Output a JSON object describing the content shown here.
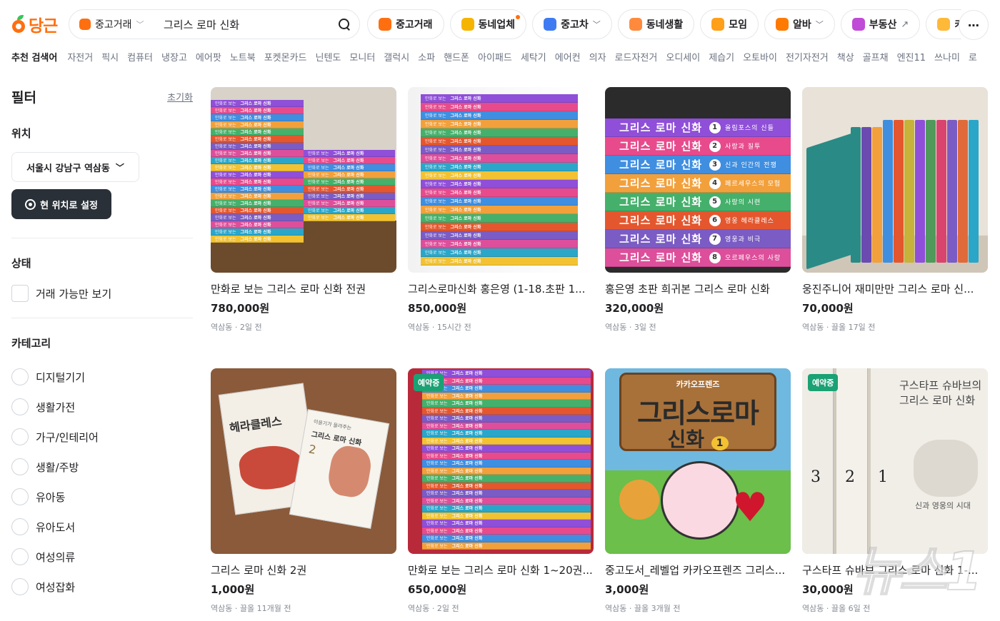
{
  "app": {
    "logo_text": "당근"
  },
  "search": {
    "category": "중고거래",
    "query": "그리스 로마 신화"
  },
  "nav_pills": [
    {
      "label": "중고거래",
      "icon": "used-goods-icon",
      "color": "#ff6f0f"
    },
    {
      "label": "동네업체",
      "icon": "local-store-icon",
      "color": "#f5b400",
      "dot": true
    },
    {
      "label": "중고차",
      "icon": "car-icon",
      "color": "#3e7bf2",
      "chevron": true
    },
    {
      "label": "동네생활",
      "icon": "community-icon",
      "color": "#ff8a3d"
    },
    {
      "label": "모임",
      "icon": "group-icon",
      "color": "#ff9f1a"
    },
    {
      "label": "알바",
      "icon": "job-icon",
      "color": "#ff7a00",
      "chevron": true
    },
    {
      "label": "부동산",
      "icon": "house-icon",
      "color": "#c04bd6",
      "external": true
    },
    {
      "label": "카",
      "icon": "more-service-icon",
      "color": "#ffb938"
    }
  ],
  "keywords": {
    "label": "추천 검색어",
    "items": [
      "자전거",
      "픽시",
      "컴퓨터",
      "냉장고",
      "에어팟",
      "노트북",
      "포켓몬카드",
      "닌텐도",
      "모니터",
      "갤럭시",
      "소파",
      "핸드폰",
      "아이패드",
      "세탁기",
      "에어컨",
      "의자",
      "로드자전거",
      "오디세이",
      "제습기",
      "오토바이",
      "전기자전거",
      "책상",
      "골프채",
      "엔진11",
      "쓰나미",
      "로"
    ]
  },
  "sidebar": {
    "title": "필터",
    "reset": "초기화",
    "location_title": "위치",
    "location_value": "서울시 강남구 역삼동",
    "current_location_button": "현 위치로 설정",
    "status_title": "상태",
    "status_option": "거래 가능만 보기",
    "category_title": "카테고리",
    "categories": [
      "디지털기기",
      "생활가전",
      "가구/인테리어",
      "생활/주방",
      "유아동",
      "유아도서",
      "여성의류",
      "여성잡화"
    ]
  },
  "products": [
    {
      "title": "만화로 보는 그리스 로마 신화 전권",
      "price": "780,000원",
      "meta": "역삼동 · 2일 전"
    },
    {
      "title": "그리스로마신화 홍은영 (1-18.초판 1...",
      "price": "850,000원",
      "meta": "역삼동 · 15시간 전"
    },
    {
      "title": "홍은영 초판 희귀본 그리스 로마 신화",
      "price": "320,000원",
      "meta": "역삼동 · 3일 전"
    },
    {
      "title": "웅진주니어 재미만만 그리스 로마 신...",
      "price": "70,000원",
      "meta": "역삼동 · 끌올 17일 전"
    },
    {
      "title": "그리스 로마 신화 2권",
      "price": "1,000원",
      "meta": "역삼동 · 끌올 11개월 전"
    },
    {
      "title": "만화로 보는 그리스 로마 신화 1~20권...",
      "price": "650,000원",
      "meta": "역삼동 · 2일 전",
      "badge": "예약중"
    },
    {
      "title": "중고도서_레벨업 카카오프렌즈 그리스...",
      "price": "3,000원",
      "meta": "역삼동 · 끌올 3개월 전"
    },
    {
      "title": "구스타프 슈바브 그리스 로마 신화 1-...",
      "price": "30,000원",
      "meta": "역삼동 · 끌올 6일 전",
      "badge": "예약중"
    }
  ],
  "thumbnail_text": {
    "spine_title": "그리스 로마 신화",
    "spine_prefix": "만화로 보는",
    "big_spines": [
      {
        "title": "그리스 로마 신화",
        "num": "1",
        "sub": "올림포스의 신들"
      },
      {
        "title": "그리스 로마 신화",
        "num": "2",
        "sub": "사랑과 질투"
      },
      {
        "title": "그리스 로마 신화",
        "num": "3",
        "sub": "신과 인간의 전쟁"
      },
      {
        "title": "그리스 로마 신화",
        "num": "4",
        "sub": "페르세우스의 모험"
      },
      {
        "title": "그리스 로마 신화",
        "num": "5",
        "sub": "사랑의 시련"
      },
      {
        "title": "그리스 로마 신화",
        "num": "6",
        "sub": "영웅 헤라클레스"
      },
      {
        "title": "그리스 로마 신화",
        "num": "7",
        "sub": "영웅과 비극"
      },
      {
        "title": "그리스 로마 신화",
        "num": "8",
        "sub": "오르페우스의 사랑"
      }
    ],
    "heracles_title": "헤라클레스",
    "book2_series": "이윤기가 들려주는",
    "book2_title": "그리스 로마 신화",
    "book2_num": "2",
    "kakao_series": "카카오프렌즈",
    "kakao_title": "그리스로마",
    "kakao_title2": "신화",
    "kakao_badge": "1",
    "schwab_title": "구스타프 슈바브의 그리스 로마 신화",
    "schwab_vol1": "1",
    "schwab_vol2": "2",
    "schwab_vol3": "3",
    "schwab_sub": "신과 영웅의 시대",
    "watermark": "뉴스1"
  },
  "colors": {
    "brand": "#ff6f0f",
    "reserved_badge": "#1aa174",
    "spine_palette": [
      "#8f4fd8",
      "#e74b8c",
      "#3f8ee0",
      "#f2a03c",
      "#45b06b",
      "#e4572e",
      "#7a5cc4",
      "#dd4f9a",
      "#2aa6c9",
      "#f2c233"
    ]
  }
}
